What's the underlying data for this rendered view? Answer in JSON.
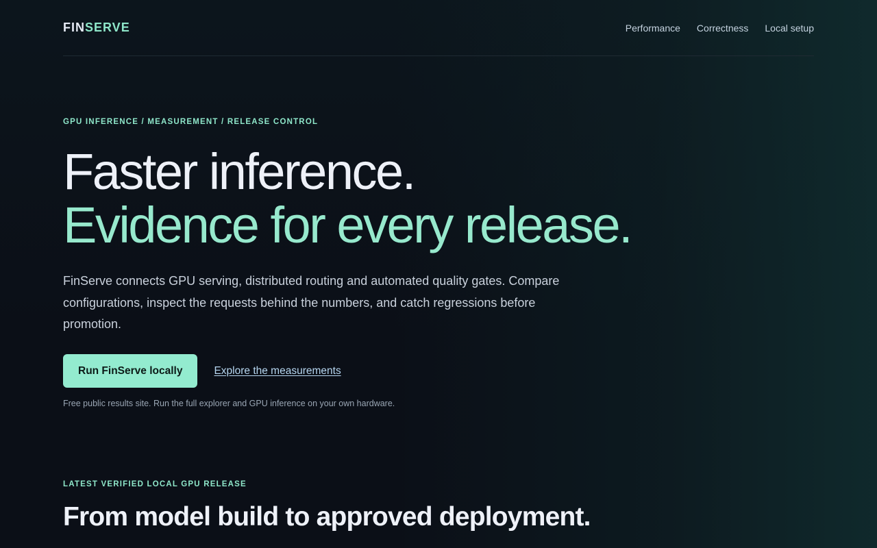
{
  "brand": {
    "part1": "FIN",
    "part2": "SERVE"
  },
  "nav": {
    "items": [
      {
        "label": "Performance"
      },
      {
        "label": "Correctness"
      },
      {
        "label": "Local setup"
      }
    ]
  },
  "hero": {
    "eyebrow": "GPU INFERENCE / MEASUREMENT / RELEASE CONTROL",
    "headline_line1": "Faster inference.",
    "headline_line2": "Evidence for every release.",
    "lede": "FinServe connects GPU serving, distributed routing and automated quality gates. Compare configurations, inspect the requests behind the numbers, and catch regressions before promotion.",
    "primary_cta": "Run FinServe locally",
    "secondary_cta": "Explore the measurements",
    "note": "Free public results site. Run the full explorer and GPU inference on your own hardware."
  },
  "section": {
    "eyebrow": "LATEST VERIFIED LOCAL GPU RELEASE",
    "title": "From model build to approved deployment."
  },
  "colors": {
    "background": "#0b0f17",
    "accent": "#93ebcf",
    "text": "#eef1f8"
  }
}
